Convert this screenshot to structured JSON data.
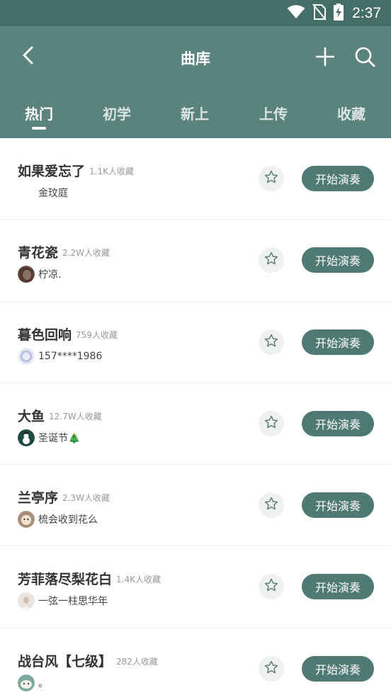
{
  "status_bar": {
    "time": "2:37",
    "icons": [
      "wifi-icon",
      "no-sim-icon",
      "battery-charging-icon"
    ]
  },
  "header": {
    "title": "曲库",
    "back_icon": "back-arrow-icon",
    "add_icon": "plus-icon",
    "search_icon": "search-icon"
  },
  "tabs": [
    {
      "label": "热门",
      "active": true
    },
    {
      "label": "初学",
      "active": false
    },
    {
      "label": "新上",
      "active": false
    },
    {
      "label": "上传",
      "active": false
    },
    {
      "label": "收藏",
      "active": false
    }
  ],
  "colors": {
    "status_bar": "#456e69",
    "app_bar": "#5a837d",
    "play_button": "#4f7a74",
    "star_bg": "#eef1f0"
  },
  "songs": [
    {
      "title": "如果爱忘了",
      "favorites": "1.1K人收藏",
      "uploader": "金玟庭",
      "avatar": "none",
      "play_label": "开始演奏"
    },
    {
      "title": "青花瓷",
      "favorites": "2.2W人收藏",
      "uploader": "柠凉.",
      "avatar": "portrait-dark",
      "play_label": "开始演奏"
    },
    {
      "title": "暮色回响",
      "favorites": "759人收藏",
      "uploader": "157****1986",
      "avatar": "ring-light",
      "play_label": "开始演奏"
    },
    {
      "title": "大鱼",
      "favorites": "12.7W人收藏",
      "uploader": "圣诞节🎄",
      "avatar": "snowman-green",
      "play_label": "开始演奏"
    },
    {
      "title": "兰亭序",
      "favorites": "2.3W人收藏",
      "uploader": "梳会收到花么",
      "avatar": "cartoon-brown",
      "play_label": "开始演奏"
    },
    {
      "title": "芳菲落尽梨花白",
      "favorites": "1.4K人收藏",
      "uploader": "一弦一柱思华年",
      "avatar": "portrait-light",
      "play_label": "开始演奏"
    },
    {
      "title": "战台风【七级】",
      "favorites": "282人收藏",
      "uploader": "。",
      "avatar": "cartoon-teal",
      "play_label": "开始演奏"
    }
  ]
}
